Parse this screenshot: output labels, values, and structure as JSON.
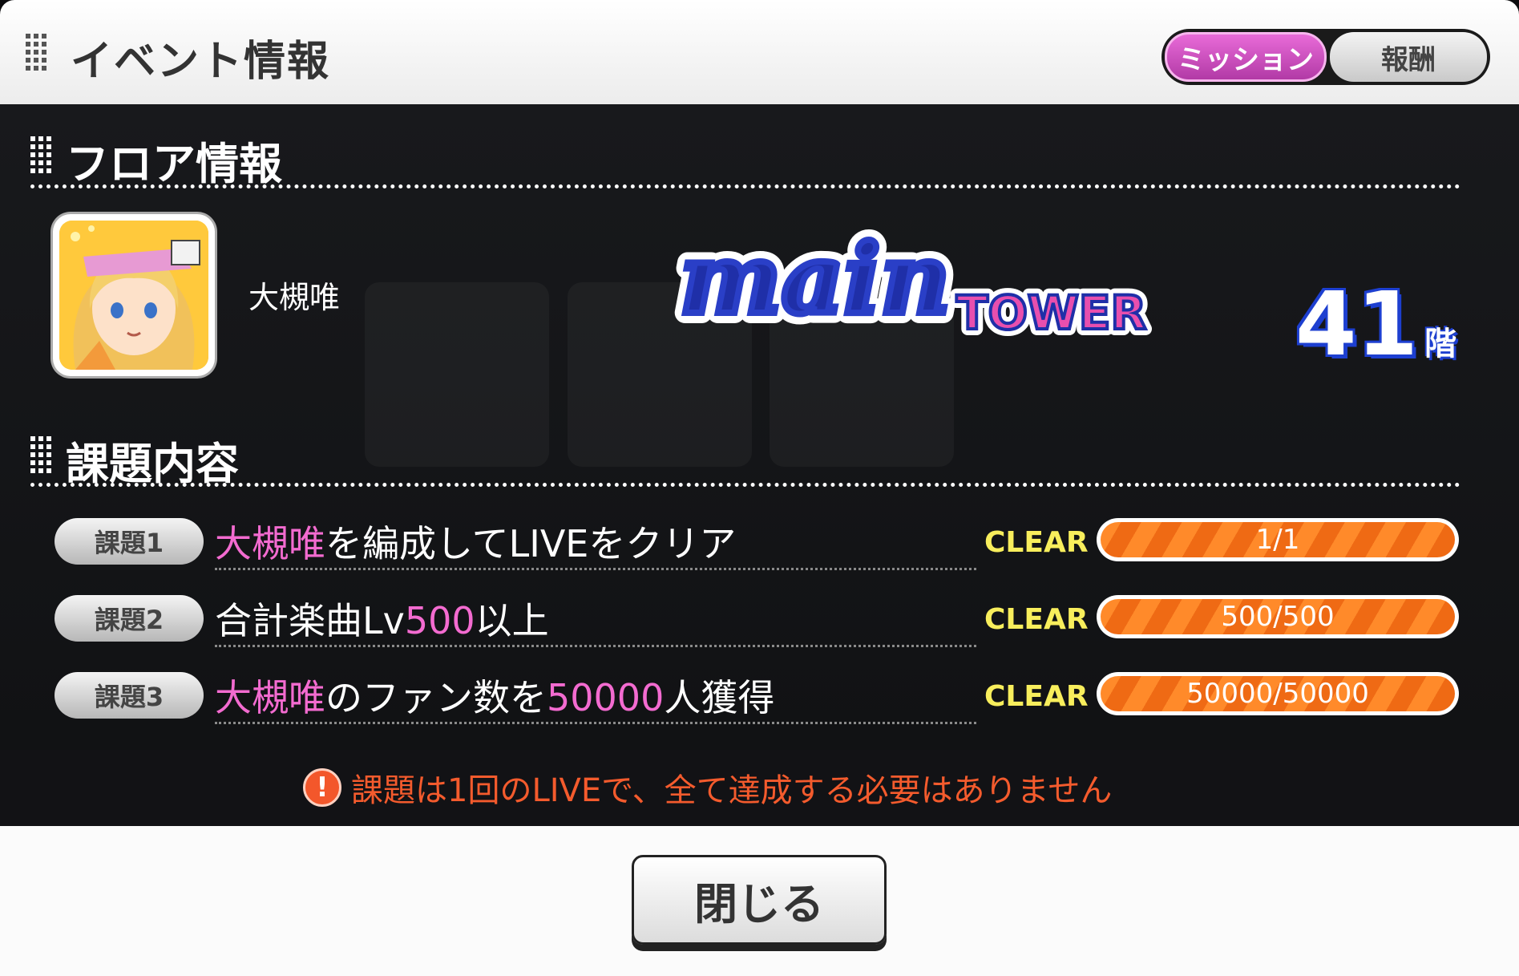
{
  "header": {
    "title": "イベント情報",
    "tabs": [
      {
        "label": "ミッション",
        "active": true
      },
      {
        "label": "報酬",
        "active": false
      }
    ]
  },
  "floor_section": {
    "title": "フロア情報",
    "idol_name": "大槻唯",
    "tower": {
      "main_word": "main",
      "tower_word": "TOWER"
    },
    "floor_number": "41",
    "floor_unit": "階"
  },
  "tasks_section": {
    "title": "課題内容",
    "tasks": [
      {
        "badge": "課題1",
        "status": "CLEAR",
        "progress_label": "1/1",
        "progress": 1.0
      },
      {
        "badge": "課題2",
        "status": "CLEAR",
        "progress_label": "500/500",
        "progress": 1.0
      },
      {
        "badge": "課題3",
        "status": "CLEAR",
        "progress_label": "50000/50000",
        "progress": 1.0
      }
    ],
    "task_text": {
      "t1_a": "大槻唯",
      "t1_b": "を編成してLIVEをクリア",
      "t2_a": "合計楽曲Lv",
      "t2_b": "500",
      "t2_c": "以上",
      "t3_a": "大槻唯",
      "t3_b": "のファン数を",
      "t3_c": "50000",
      "t3_d": "人獲得"
    },
    "notice": "課題は1回のLIVEで、全て達成する必要はありません"
  },
  "footer": {
    "close_label": "閉じる"
  },
  "colors": {
    "accent_pink": "#f36bd0",
    "clear_yellow": "#f8ee5c",
    "progress_orange": "#ff8a2a",
    "notice_red": "#f45b2d"
  }
}
